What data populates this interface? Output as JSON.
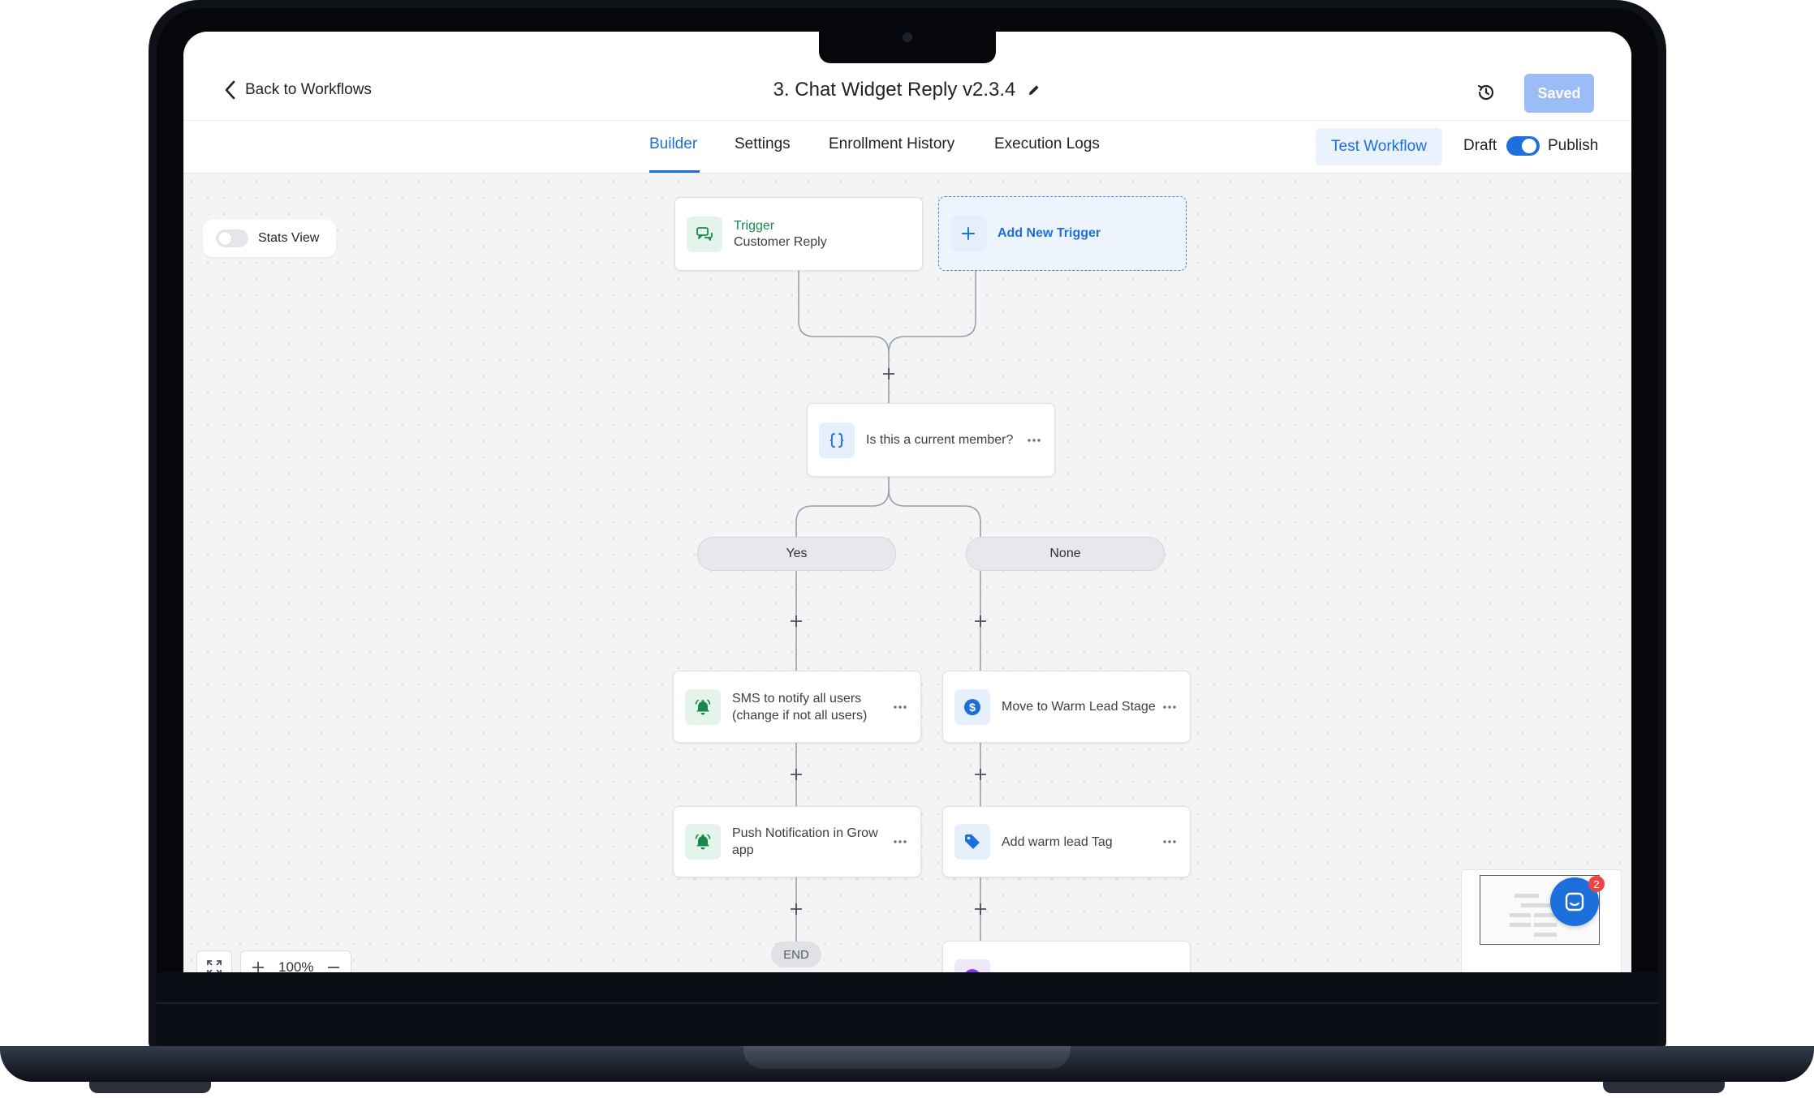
{
  "header": {
    "back_label": "Back to Workflows",
    "title": "3. Chat Widget Reply v2.3.4",
    "saved_label": "Saved"
  },
  "tabs": [
    {
      "label": "Builder",
      "active": true
    },
    {
      "label": "Settings",
      "active": false
    },
    {
      "label": "Enrollment History",
      "active": false
    },
    {
      "label": "Execution Logs",
      "active": false
    }
  ],
  "actions": {
    "test_label": "Test Workflow",
    "draft_label": "Draft",
    "publish_label": "Publish",
    "publish_enabled": true
  },
  "canvas": {
    "stats_view_label": "Stats View",
    "stats_view_enabled": false,
    "zoom": "100%",
    "chat_badge_count": "2"
  },
  "workflow": {
    "trigger": {
      "label": "Trigger",
      "name": "Customer Reply"
    },
    "add_trigger_label": "Add New Trigger",
    "condition": {
      "label": "Is this a current member?"
    },
    "branches": [
      "Yes",
      "None"
    ],
    "yes_steps": [
      {
        "label": "SMS to notify all users (change if not all users)",
        "icon": "bell-icon"
      },
      {
        "label": "Push Notification in Grow app",
        "icon": "bell-icon"
      }
    ],
    "none_steps": [
      {
        "label": "Move to Warm Lead Stage",
        "icon": "dollar-icon"
      },
      {
        "label": "Add warm lead Tag",
        "icon": "tag-icon"
      }
    ],
    "end_label": "END"
  },
  "colors": {
    "accent": "#1d6fdc",
    "trigger_green": "#17884a",
    "saved_disabled": "#9bbcf7",
    "badge_red": "#ef4444"
  }
}
